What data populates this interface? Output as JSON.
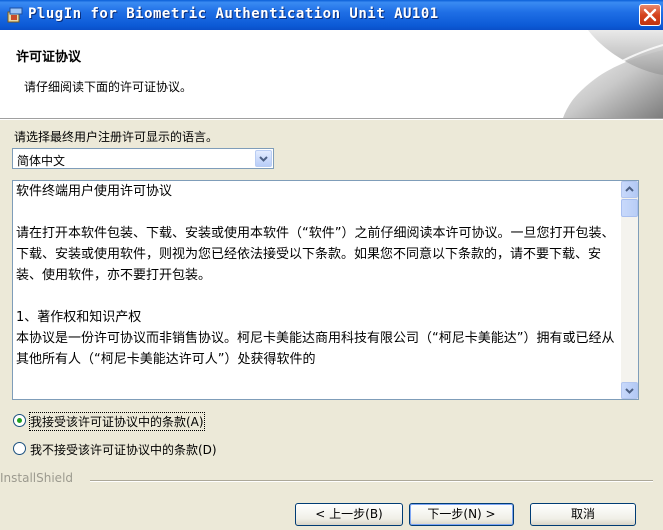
{
  "window": {
    "title": "PlugIn for Biometric Authentication Unit AU101",
    "icons": {
      "app": "installer-icon",
      "close": "close-icon"
    }
  },
  "banner": {
    "title": "许可证协议",
    "subtitle": "请仔细阅读下面的许可证协议。"
  },
  "language": {
    "label": "请选择最终用户注册许可显示的语言。",
    "selected": "简体中文"
  },
  "license": {
    "paragraphs": [
      "软件终端用户使用许可协议",
      "",
      "请在打开本软件包装、下载、安装或使用本软件（“软件”）之前仔细阅读本许可协议。一旦您打开包装、下载、安装或使用软件，则视为您已经依法接受以下条款。如果您不同意以下条款的，请不要下载、安装、使用软件，亦不要打开包装。",
      "",
      "1、著作权和知识产权",
      "本协议是一份许可协议而非销售协议。柯尼卡美能达商用科技有限公司（“柯尼卡美能达”）拥有或已经从其他所有人（“柯尼卡美能达许可人”）处获得软件的"
    ]
  },
  "radios": {
    "accept": "我接受该许可证协议中的条款(A)",
    "decline": "我不接受该许可证协议中的条款(D)",
    "selected": "accept"
  },
  "footer": {
    "brand": "InstallShield",
    "back": "< 上一步(B)",
    "next": "下一步(N) >",
    "cancel": "取消"
  },
  "colors": {
    "titlebar": "#0a5fd8",
    "dialog_bg": "#ece9d8",
    "radio_dot": "#21a121",
    "close_button": "#d5431d"
  }
}
